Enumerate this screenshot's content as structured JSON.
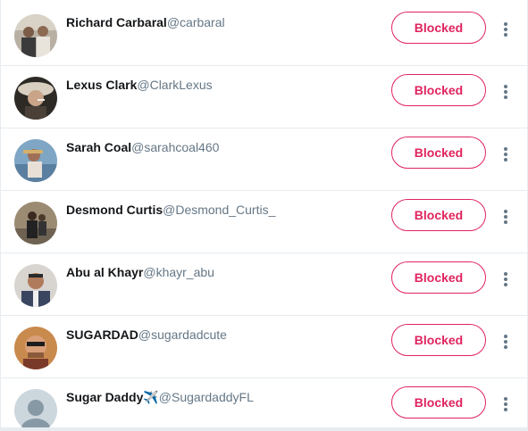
{
  "colors": {
    "accent": "#e0245e",
    "divider": "#e6ecf0",
    "name_text": "#14171a",
    "handle_text": "#657786"
  },
  "users": [
    {
      "name": "Richard Carbaral",
      "handle": "@carbaral",
      "button_label": "Blocked",
      "avatar": "photo"
    },
    {
      "name": "Lexus Clark",
      "handle": "@ClarkLexus",
      "button_label": "Blocked",
      "avatar": "photo"
    },
    {
      "name": "Sarah Coal",
      "handle": "@sarahcoal460",
      "button_label": "Blocked",
      "avatar": "photo"
    },
    {
      "name": "Desmond Curtis",
      "handle": "@Desmond_Curtis_",
      "button_label": "Blocked",
      "avatar": "photo"
    },
    {
      "name": "Abu al Khayr",
      "handle": "@khayr_abu",
      "button_label": "Blocked",
      "avatar": "photo"
    },
    {
      "name": "SUGARDAD",
      "handle": "@sugardadcute",
      "button_label": "Blocked",
      "avatar": "photo"
    },
    {
      "name": "Sugar Daddy",
      "name_emoji": "✈️",
      "handle": "@SugardaddyFL",
      "button_label": "Blocked",
      "avatar": "default-silhouette"
    }
  ]
}
